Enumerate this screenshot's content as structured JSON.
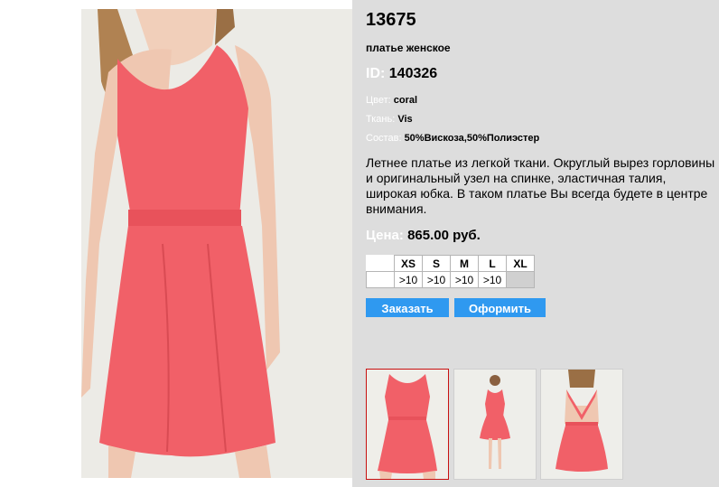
{
  "product": {
    "code": "13675",
    "title": "платье женское",
    "id_label": "ID:",
    "id_value": "140326",
    "color_label": "Цвет:",
    "color_value": "coral",
    "fabric_label": "Ткань:",
    "fabric_value": "Vis",
    "composition_label": "Состав:",
    "composition_value": "50%Вискоза,50%Полиэстер",
    "description": "Летнее платье из легкой ткани. Округлый вырез горловины и оригинальный узел на спинке, эластичная талия, широкая юбка. В таком платье Вы всегда будете в центре внимания.",
    "price_label": "Цена:",
    "price_value": "865.00 руб."
  },
  "sizes": {
    "headers": [
      "XS",
      "S",
      "M",
      "L",
      "XL"
    ],
    "availability": [
      ">10",
      ">10",
      ">10",
      ">10",
      ""
    ]
  },
  "buttons": {
    "order_label": "Заказать",
    "checkout_label": "Оформить"
  },
  "colors": {
    "dress": "#f16068",
    "panel": "#dddddd",
    "button": "#2f99f0",
    "thumb_selected_border": "#c81010"
  },
  "thumbnails": [
    "front-view",
    "full-length-view",
    "back-view"
  ]
}
